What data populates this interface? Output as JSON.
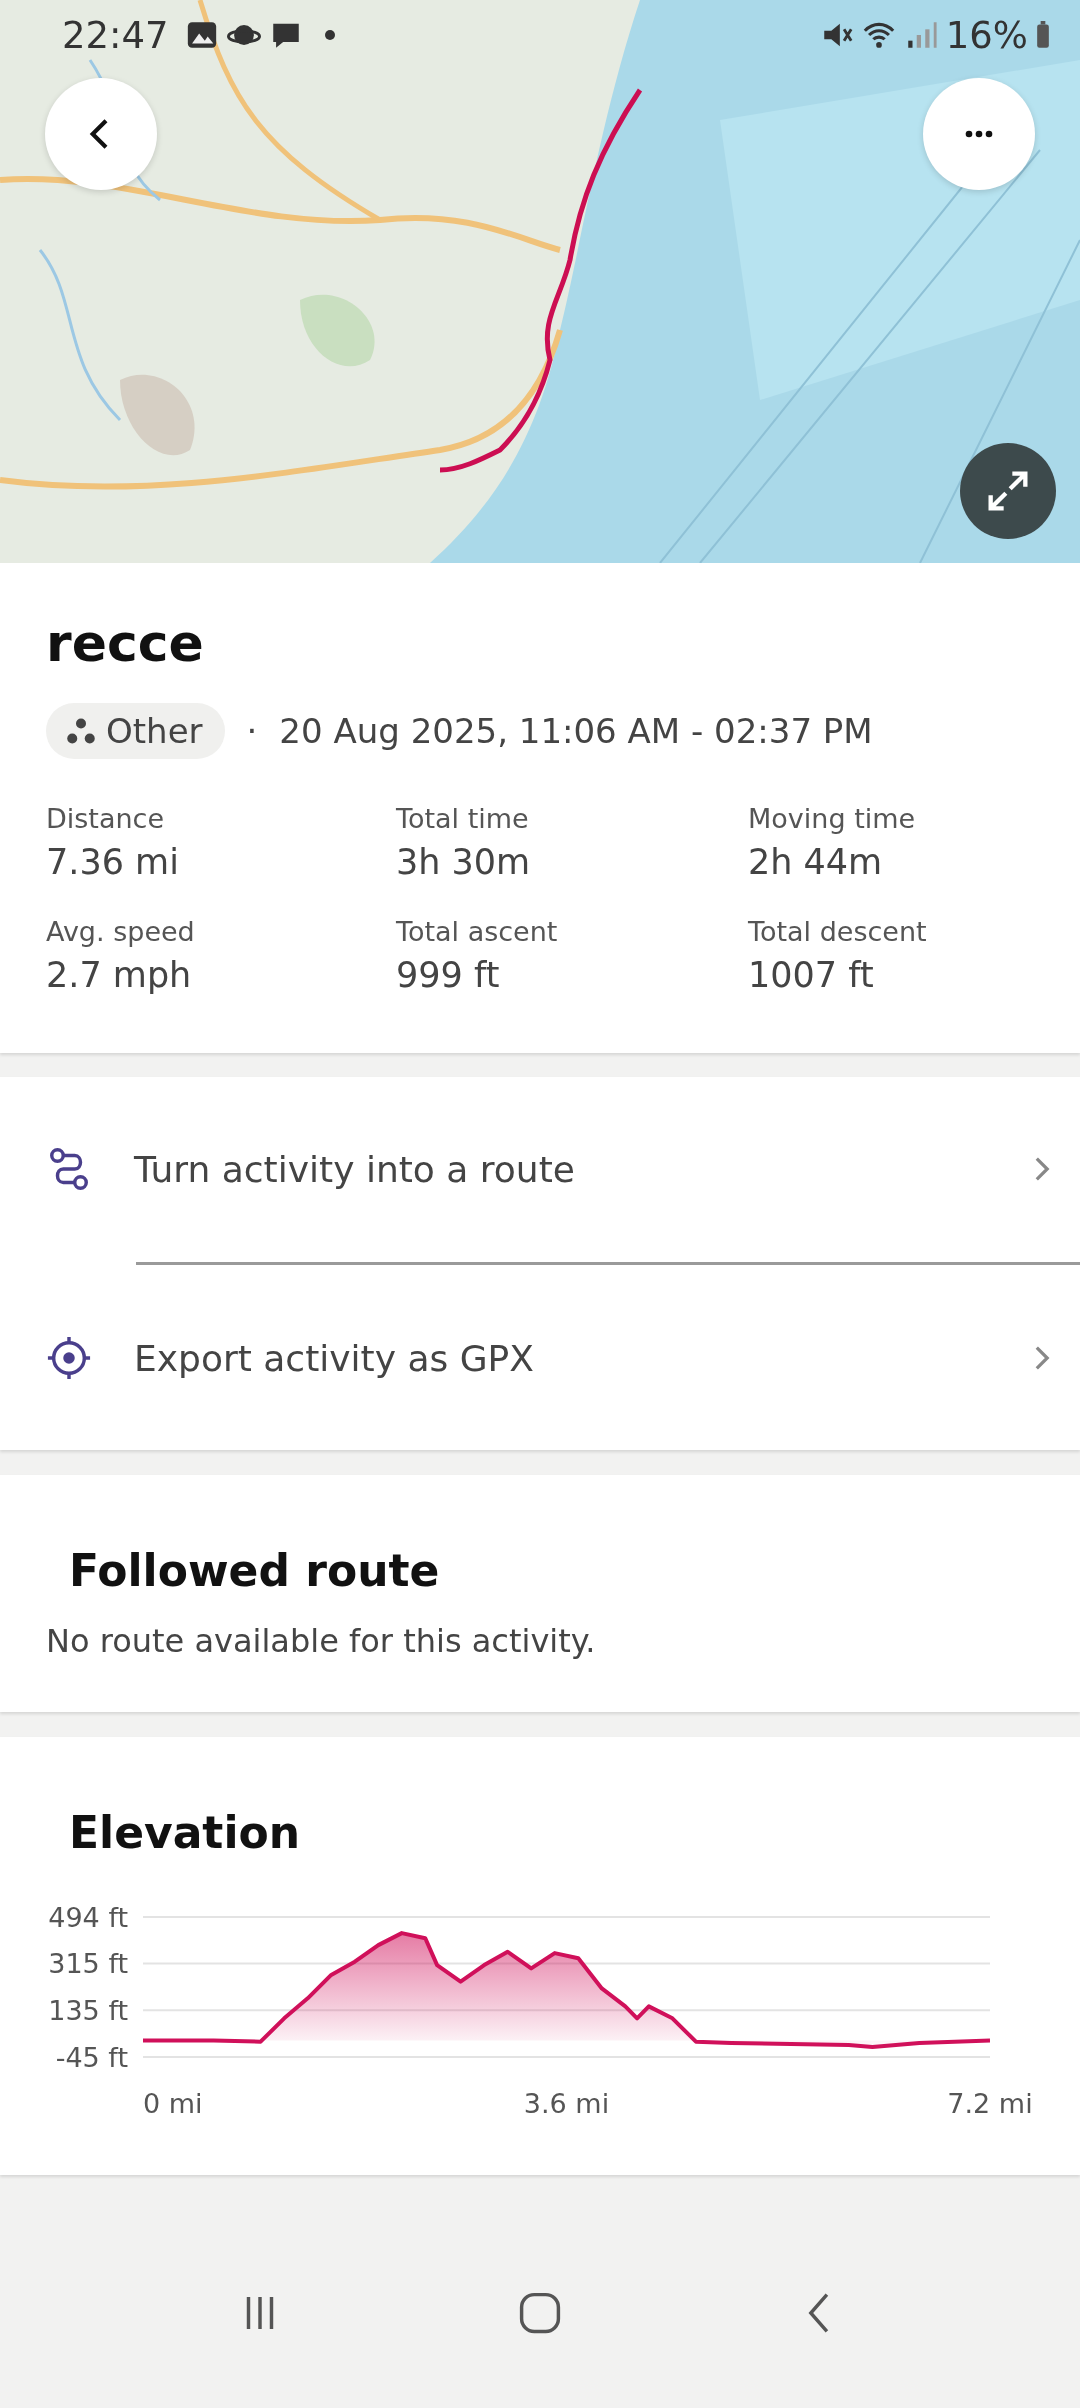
{
  "status_bar": {
    "time": "22:47",
    "battery": "16%"
  },
  "activity": {
    "title": "recce",
    "type": "Other",
    "separator": "·",
    "date": "20 Aug 2025, 11:06 AM - 02:37 PM",
    "stats": [
      {
        "label": "Distance",
        "value": "7.36 mi"
      },
      {
        "label": "Total time",
        "value": "3h 30m"
      },
      {
        "label": "Moving time",
        "value": "2h 44m"
      },
      {
        "label": "Avg. speed",
        "value": "2.7 mph"
      },
      {
        "label": "Total ascent",
        "value": "999 ft"
      },
      {
        "label": "Total descent",
        "value": "1007 ft"
      }
    ]
  },
  "actions": [
    {
      "label": "Turn activity into a route",
      "kind": "route"
    },
    {
      "label": "Export activity as GPX",
      "kind": "export"
    }
  ],
  "followed_route": {
    "title": "Followed route",
    "message": "No route available for this activity."
  },
  "elevation": {
    "title": "Elevation",
    "chart_data": {
      "type": "area",
      "x": [
        0,
        0.6,
        1.0,
        1.2,
        1.4,
        1.6,
        1.8,
        2.0,
        2.2,
        2.4,
        2.5,
        2.7,
        2.9,
        3.1,
        3.3,
        3.5,
        3.7,
        3.9,
        4.1,
        4.2,
        4.3,
        4.5,
        4.7,
        5.0,
        6.0,
        6.2,
        6.6,
        7.2
      ],
      "series": [
        {
          "color": "#d0105a",
          "values": [
            19,
            19,
            14,
            104,
            181,
            271,
            322,
            386,
            432,
            412,
            309,
            245,
            309,
            360,
            296,
            355,
            335,
            219,
            150,
            104,
            150,
            104,
            14,
            9,
            1,
            -6,
            9,
            19
          ]
        }
      ],
      "xlim": [
        0,
        7.2
      ],
      "ylim": [
        -45,
        494
      ],
      "xticks": [
        {
          "value": 0,
          "label": "0 mi"
        },
        {
          "value": 3.6,
          "label": "3.6 mi"
        },
        {
          "value": 7.2,
          "label": "7.2 mi"
        }
      ],
      "yticks": [
        {
          "value": -45,
          "label": "-45 ft"
        },
        {
          "value": 135,
          "label": "135 ft"
        },
        {
          "value": 315,
          "label": "315 ft"
        },
        {
          "value": 494,
          "label": "494 ft"
        }
      ]
    }
  }
}
